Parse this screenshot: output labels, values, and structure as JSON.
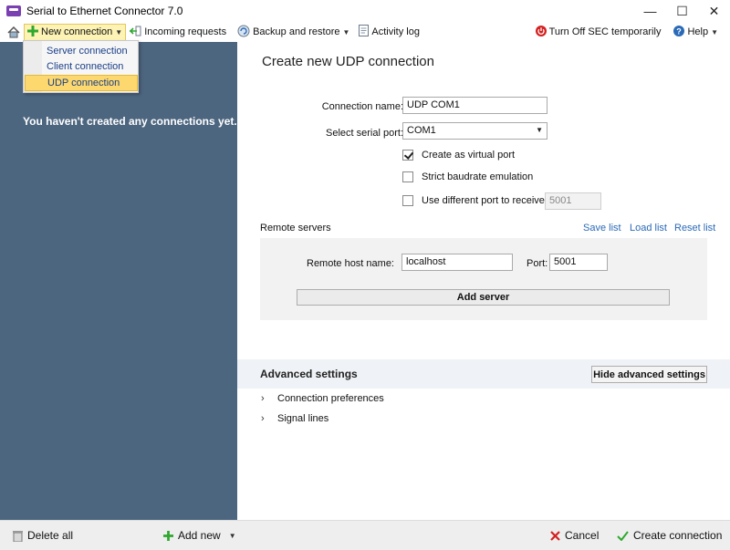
{
  "window": {
    "title": "Serial to Ethernet Connector 7.0",
    "controls": {
      "minimize": "—",
      "maximize": "☐",
      "close": "✕"
    }
  },
  "toolbar": {
    "new_connection": "New connection",
    "incoming_requests": "Incoming requests",
    "backup_restore": "Backup and restore",
    "activity_log": "Activity log",
    "turn_off": "Turn Off SEC temporarily",
    "help": "Help"
  },
  "menu": {
    "items": [
      "Server connection",
      "Client connection",
      "UDP connection"
    ],
    "selected": "UDP connection"
  },
  "left_panel": {
    "empty_message": "You haven't created any connections yet."
  },
  "form": {
    "title": "Create new UDP connection",
    "connection_name_label": "Connection name:",
    "connection_name_value": "UDP COM1",
    "serial_port_label": "Select serial port:",
    "serial_port_value": "COM1",
    "virtual_port_label": "Create as virtual port",
    "virtual_port_checked": true,
    "strict_baud_label": "Strict baudrate emulation",
    "strict_baud_checked": false,
    "diff_port_label": "Use different port to receive data:",
    "diff_port_checked": false,
    "diff_port_value": "5001"
  },
  "remote": {
    "section_label": "Remote servers",
    "save_list": "Save list",
    "load_list": "Load list",
    "reset_list": "Reset list",
    "host_label": "Remote host name:",
    "host_value": "localhost",
    "port_label": "Port:",
    "port_value": "5001",
    "add_server": "Add server"
  },
  "advanced": {
    "title": "Advanced settings",
    "hide_button": "Hide advanced settings",
    "items": [
      "Connection preferences",
      "Signal lines"
    ]
  },
  "bottom": {
    "delete_all": "Delete all",
    "add_new": "Add new",
    "cancel": "Cancel",
    "create": "Create connection"
  },
  "colors": {
    "left_panel": "#4d6680",
    "link": "#2a6ab8",
    "menu_highlight": "#fcd86e",
    "accent_green": "#2fa82f",
    "cancel_red": "#d42020"
  }
}
